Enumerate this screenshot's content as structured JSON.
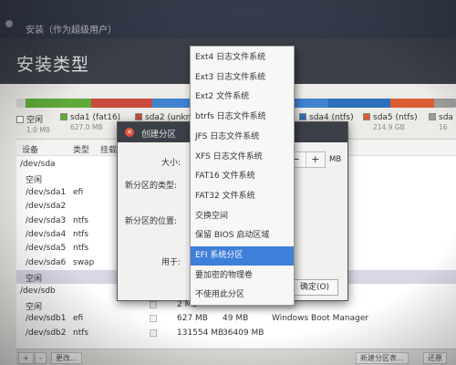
{
  "window": {
    "title": "安装（作为超级用户）"
  },
  "header": {
    "title": "安装类型"
  },
  "partition_bar": {
    "segments": [
      {
        "color": "#d5d5d5",
        "flex": 0.02
      },
      {
        "color": "#5eaa3a",
        "flex": 0.15
      },
      {
        "color": "#c84b3d",
        "flex": 0.14
      },
      {
        "color": "#3f83cf",
        "flex": 0.4
      },
      {
        "color": "#2c6fbd",
        "flex": 0.14
      },
      {
        "color": "#dc5c33",
        "flex": 0.1
      },
      {
        "color": "#9c9c9c",
        "flex": 0.05
      }
    ]
  },
  "legend": [
    {
      "label": "空闲",
      "size": "1.0 MB",
      "color": "#ffffff"
    },
    {
      "label": "sda1 (fat16)",
      "size": "627.0 MB",
      "color": "#5eaa3a"
    },
    {
      "label": "sda2 (unkn",
      "size": "",
      "color": "#c84b3d"
    },
    {
      "label": "sda4 (ntfs)",
      "size": "",
      "color": "#2c6fbd"
    },
    {
      "label": "sda5 (ntfs)",
      "size": "214.9 GB",
      "color": "#dc5c33"
    },
    {
      "label": "sda",
      "size": "16",
      "color": "#9c9c9c"
    }
  ],
  "table": {
    "headers": [
      "设备",
      "类型",
      "挂载"
    ],
    "rows": [
      {
        "device": "/dev/sda",
        "type": "",
        "size": "",
        "used": "",
        "system": ""
      },
      {
        "device": "空闲",
        "type": "",
        "size": "",
        "used": "",
        "system": ""
      },
      {
        "device": "/dev/sda1",
        "type": "efi",
        "size": "",
        "used": "",
        "system": ""
      },
      {
        "device": "/dev/sda2",
        "type": "",
        "size": "",
        "used": "",
        "system": ""
      },
      {
        "device": "/dev/sda3",
        "type": "ntfs",
        "size": "",
        "used": "",
        "system": ""
      },
      {
        "device": "/dev/sda4",
        "type": "ntfs",
        "size": "",
        "used": "",
        "system": ""
      },
      {
        "device": "/dev/sda5",
        "type": "ntfs",
        "size": "",
        "used": "",
        "system": ""
      },
      {
        "device": "/dev/sda6",
        "type": "swap",
        "size": "",
        "used": "",
        "system": ""
      },
      {
        "device": "空闲",
        "type": "",
        "size": "",
        "used": "",
        "system": ""
      },
      {
        "device": "/dev/sdb",
        "type": "",
        "size": "",
        "used": "",
        "system": ""
      },
      {
        "device": "空闲",
        "type": "",
        "size": "2 MB",
        "used": "",
        "system": ""
      },
      {
        "device": "/dev/sdb1",
        "type": "efi",
        "size": "627 MB",
        "used": "49 MB",
        "system": "Windows Boot Manager"
      },
      {
        "device": "/dev/sdb2",
        "type": "ntfs",
        "size": "131554 MB",
        "used": "36409 MB",
        "system": ""
      }
    ]
  },
  "bottombar": {
    "add": "+",
    "remove": "-",
    "change": "更改...",
    "new_table": "新建分区表...",
    "restore": "还原"
  },
  "dialog": {
    "title": "创建分区",
    "size_label": "大小:",
    "type_label": "新分区的类型:",
    "location_label": "新分区的位置:",
    "use_label": "用于:",
    "minus": "−",
    "plus": "+",
    "unit": "MB",
    "ok_label": "确定(O)"
  },
  "menu": {
    "items": [
      "Ext4 日志文件系统",
      "Ext3 日志文件系统",
      "Ext2 文件系统",
      "btrfs 日志文件系统",
      "JFS 日志文件系统",
      "XFS 日志文件系统",
      "FAT16 文件系统",
      "FAT32 文件系统",
      "交换空间",
      "保留 BIOS 启动区域",
      "EFI 系统分区",
      "要加密的物理卷",
      "不使用此分区"
    ],
    "active_index": 10
  }
}
